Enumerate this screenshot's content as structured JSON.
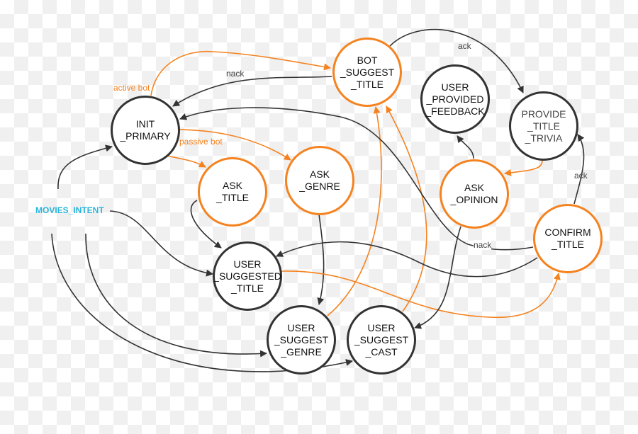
{
  "colors": {
    "active_state": "#f5821f",
    "passive_state": "#333333",
    "intent": "#2cb5dc"
  },
  "intent": "MOVIES_INTENT",
  "nodes": {
    "init_primary": "INIT\n_PRIMARY",
    "ask_title": "ASK\n_TITLE",
    "ask_genre": "ASK\n_GENRE",
    "bot_suggest_title": "BOT\n_SUGGEST\n_TITLE",
    "user_provided_feedback": "USER\n_PROVIDED\n_FEEDBACK",
    "provide_title_trivia": "PROVIDE\n_TITLE\n_TRIVIA",
    "ask_opinion": "ASK\n_OPINION",
    "confirm_title": "CONFIRM\n_TITLE",
    "user_suggested_title": "USER\n_SUGGESTED\n_TITLE",
    "user_suggest_genre": "USER\n_SUGGEST\n_GENRE",
    "user_suggest_cast": "USER\n_SUGGEST\n_CAST"
  },
  "edge_labels": {
    "active_bot": "active bot",
    "passive_bot": "passive bot",
    "nack_top": "nack",
    "ack_top": "ack",
    "ack_right": "ack",
    "nack_confirm": "nack"
  }
}
